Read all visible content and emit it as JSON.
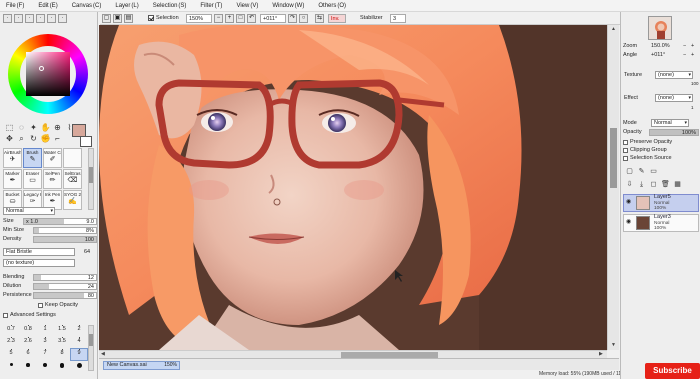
{
  "menubar": {
    "items": [
      {
        "label": "File",
        "shortcut": "(F)"
      },
      {
        "label": "Edit",
        "shortcut": "(E)"
      },
      {
        "label": "Canvas",
        "shortcut": "(C)"
      },
      {
        "label": "Layer",
        "shortcut": "(L)"
      },
      {
        "label": "Selection",
        "shortcut": "(S)"
      },
      {
        "label": "Filter",
        "shortcut": "(T)"
      },
      {
        "label": "View",
        "shortcut": "(V)"
      },
      {
        "label": "Window",
        "shortcut": "(W)"
      },
      {
        "label": "Others",
        "shortcut": "(O)"
      }
    ]
  },
  "toolbar": {
    "selection_label": "Selection",
    "selection_checked": true,
    "zoom": "150%",
    "rotation": "+011°",
    "invert_label": "Inv.",
    "stabilizer_label": "Stabilizer",
    "stabilizer_value": "3"
  },
  "color": {
    "main": "#d7a89b",
    "secondary": "#ffffff"
  },
  "tools": {
    "row1": [
      "select-rect-icon",
      "lasso-icon",
      "magic-wand-icon",
      "hand-icon",
      "zoom-icon",
      "eyedropper-icon"
    ],
    "row2": [
      "move-icon",
      "magnify-icon",
      "rotate-icon",
      "grab-icon",
      "pick-icon"
    ]
  },
  "brushes": [
    {
      "label": "AirBrush",
      "icon": "airbrush-icon",
      "selected": false
    },
    {
      "label": "Brush",
      "icon": "brush-icon",
      "selected": true
    },
    {
      "label": "Water Color",
      "icon": "water-color-icon",
      "selected": false
    },
    {
      "label": "",
      "icon": "empty-slot",
      "selected": false
    },
    {
      "label": "Marker",
      "icon": "marker-icon",
      "selected": false
    },
    {
      "label": "Eraser",
      "icon": "eraser-icon",
      "selected": false
    },
    {
      "label": "SelPen",
      "icon": "selpen-icon",
      "selected": false
    },
    {
      "label": "SelEras",
      "icon": "seleras-icon",
      "selected": false
    },
    {
      "label": "Bucket",
      "icon": "bucket-icon",
      "selected": false
    },
    {
      "label": "Legacy Pen",
      "icon": "legacy-pen-icon",
      "selected": false
    },
    {
      "label": "Ink Pen",
      "icon": "ink-pen-icon",
      "selected": false
    },
    {
      "label": "SYOG 2",
      "icon": "syog-icon",
      "selected": false
    }
  ],
  "brush_settings": {
    "mode": "Normal",
    "size_label": "Size",
    "size_mult": "x 1.0",
    "size_value": "9.0",
    "size_fill": 0.55,
    "min_size_label": "Min Size",
    "min_size_value": "8%",
    "min_size_fill": 0.08,
    "density_label": "Density",
    "density_value": "100",
    "density_fill": 1.0,
    "shape": "Flat Bristle",
    "shape_value": "64",
    "texture": "(no texture)",
    "blending_label": "Blending",
    "blending_value": "12",
    "blending_fill": 0.12,
    "dilution_label": "Dilution",
    "dilution_value": "24",
    "dilution_fill": 0.24,
    "persistence_label": "Persistence",
    "persistence_value": "80",
    "persistence_fill": 0.8,
    "keep_opacity_label": "Keep Opacity",
    "advanced_label": "Advanced Settings"
  },
  "size_presets": [
    {
      "label": "0.7",
      "dot": 0
    },
    {
      "label": "0.8",
      "dot": 0
    },
    {
      "label": "1",
      "dot": 0
    },
    {
      "label": "1.5",
      "dot": 0
    },
    {
      "label": "2",
      "dot": 0
    },
    {
      "label": "2.3",
      "dot": 0
    },
    {
      "label": "2.6",
      "dot": 0
    },
    {
      "label": "3",
      "dot": 0
    },
    {
      "label": "3.5",
      "dot": 0
    },
    {
      "label": "4",
      "dot": 0
    },
    {
      "label": "5",
      "dot": 0
    },
    {
      "label": "6",
      "dot": 0
    },
    {
      "label": "7",
      "dot": 0
    },
    {
      "label": "8",
      "dot": 0
    },
    {
      "label": "9",
      "dot": 0,
      "selected": true
    },
    {
      "label": "",
      "dot": 3
    },
    {
      "label": "",
      "dot": 3.5
    },
    {
      "label": "",
      "dot": 4
    },
    {
      "label": "",
      "dot": 4.5
    },
    {
      "label": "",
      "dot": 5
    }
  ],
  "document_tab": {
    "name": "New Canvas.sai",
    "zoom": "150%"
  },
  "status": {
    "memory": "Memory load: 55% (190MB used / 1179MB reserved)",
    "subscribe": "Subscribe"
  },
  "navigator": {
    "zoom_label": "Zoom",
    "zoom_value": "150.0%",
    "angle_label": "Angle",
    "angle_value": "+011°"
  },
  "layer_props": {
    "texture_label": "Texture",
    "texture_value": "(none)",
    "texture_value2": "100",
    "effect_label": "Effect",
    "effect_value": "(none)",
    "effect_value2": "1",
    "mode_label": "Mode",
    "mode_value": "Normal",
    "opacity_label": "Opacity",
    "opacity_value": "100%",
    "preserve_opacity": "Preserve Opacity",
    "clipping_group": "Clipping Group",
    "selection_source": "Selection Source"
  },
  "layers": [
    {
      "name": "Layer5",
      "mode": "Normal",
      "opacity": "100%",
      "selected": true,
      "thumb": "#e4c2b8"
    },
    {
      "name": "Layer3",
      "mode": "Normal",
      "opacity": "100%",
      "selected": false,
      "thumb": "#6a4436"
    }
  ],
  "canvas": {
    "background": "#5a3a2e"
  }
}
